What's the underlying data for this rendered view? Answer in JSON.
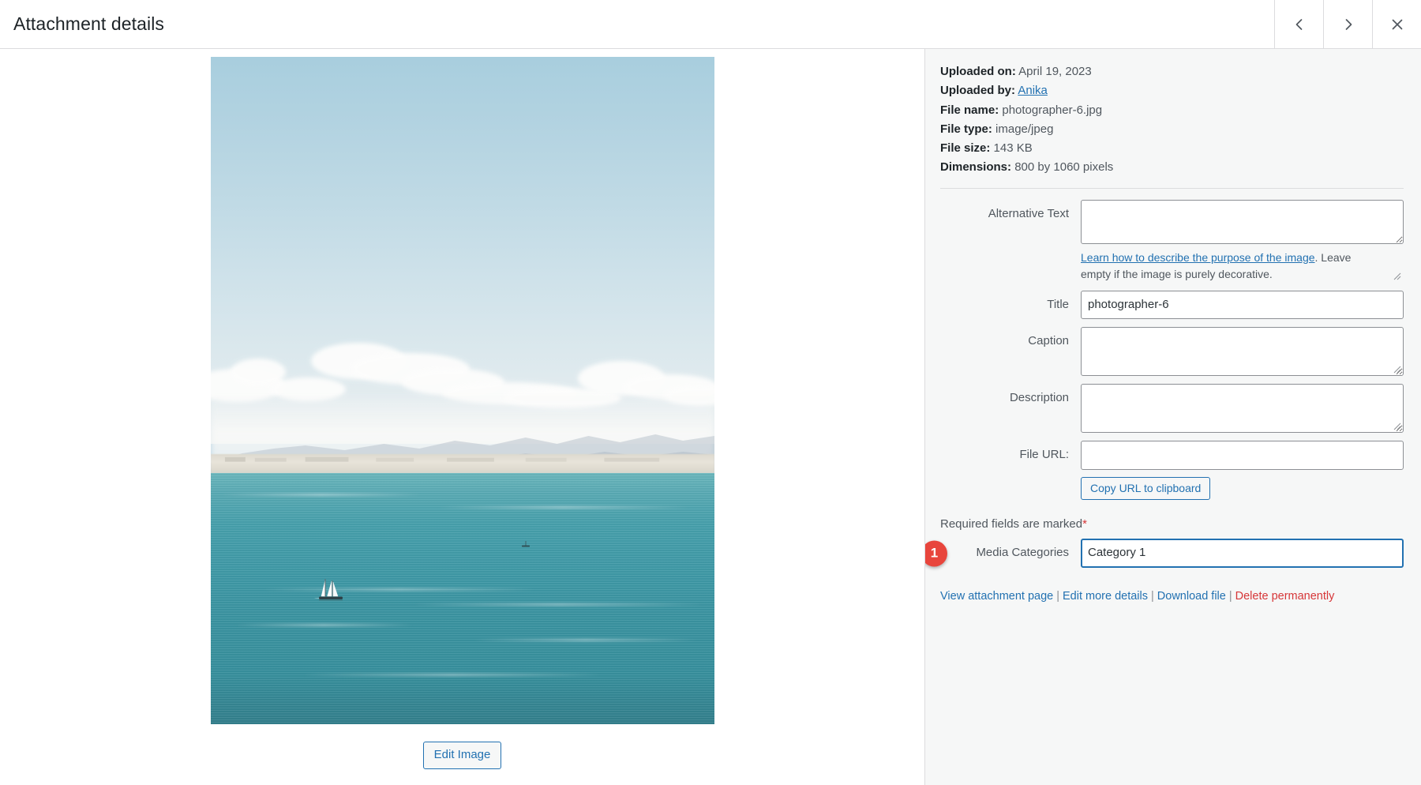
{
  "header": {
    "title": "Attachment details",
    "prev_label": "Previous",
    "next_label": "Next",
    "close_label": "Close"
  },
  "preview": {
    "edit_image_label": "Edit Image",
    "image_alt": "Sailboat on teal sea with pale blue sky, clouds and distant hazy mountains"
  },
  "meta": {
    "uploaded_on_label": "Uploaded on:",
    "uploaded_on_value": "April 19, 2023",
    "uploaded_by_label": "Uploaded by:",
    "uploaded_by_value": "Anika",
    "file_name_label": "File name:",
    "file_name_value": "photographer-6.jpg",
    "file_type_label": "File type:",
    "file_type_value": "image/jpeg",
    "file_size_label": "File size:",
    "file_size_value": "143 KB",
    "dimensions_label": "Dimensions:",
    "dimensions_value": "800 by 1060 pixels"
  },
  "fields": {
    "alt_text_label": "Alternative Text",
    "alt_text_value": "",
    "alt_help_link": "Learn how to describe the purpose of the image",
    "alt_help_rest": ". Leave empty if the image is purely decorative.",
    "title_label": "Title",
    "title_value": "photographer-6",
    "caption_label": "Caption",
    "caption_value": "",
    "description_label": "Description",
    "description_value": "",
    "file_url_label": "File URL:",
    "file_url_value": "",
    "copy_url_label": "Copy URL to clipboard"
  },
  "required": {
    "note": "Required fields are marked",
    "star": "*"
  },
  "categories": {
    "badge": "1",
    "label": "Media Categories",
    "value": "Category 1"
  },
  "links": {
    "view": "View attachment page",
    "edit_more": "Edit more details",
    "download": "Download file",
    "delete": "Delete permanently",
    "separator": "|"
  },
  "colors": {
    "accent_blue": "#2271b1",
    "danger_red": "#d63638",
    "badge_red": "#e8453c",
    "panel_bg": "#f6f7f7"
  }
}
